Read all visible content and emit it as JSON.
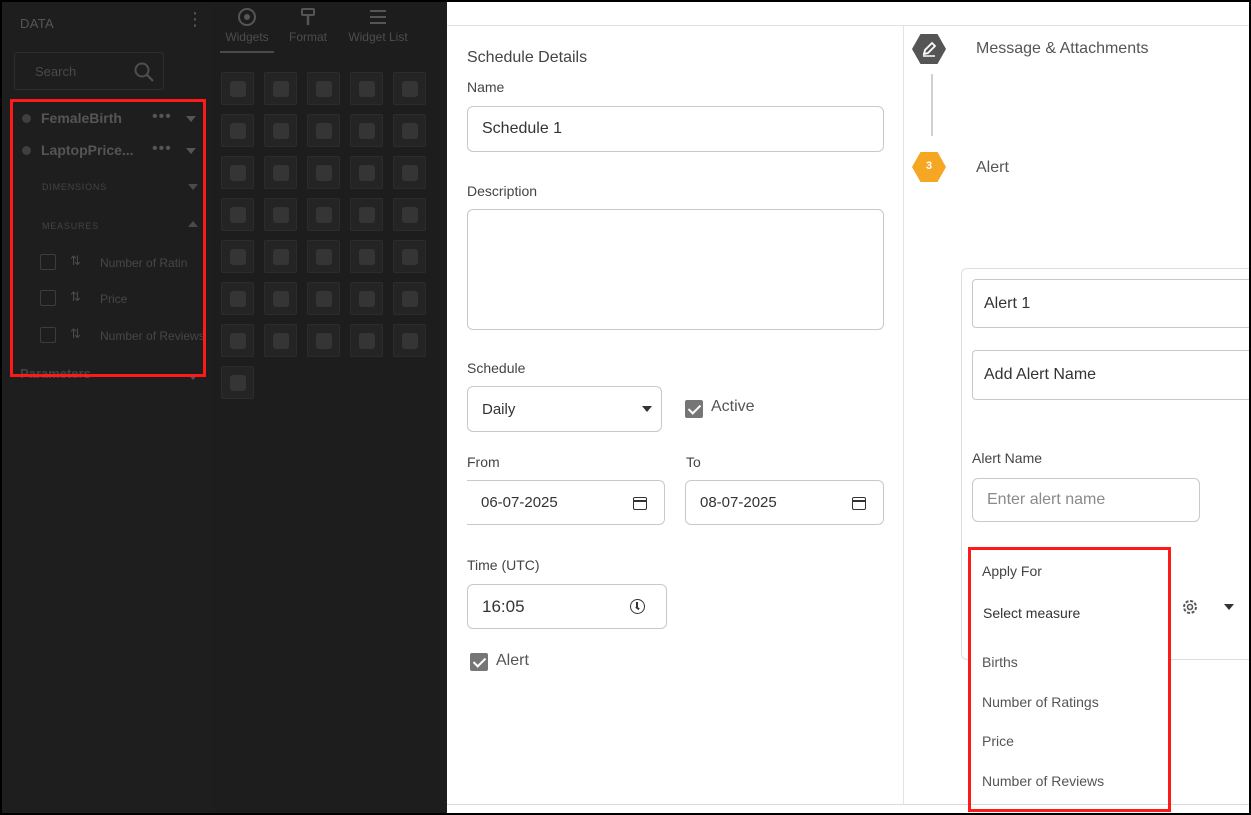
{
  "left_panel": {
    "title": "DATA",
    "search_placeholder": "Search",
    "toolbar": [
      {
        "label": "Widgets",
        "icon": "widgets-icon"
      },
      {
        "label": "Format",
        "icon": "format-icon"
      },
      {
        "label": "Widget List",
        "icon": "widget-list-icon"
      }
    ],
    "datasources": [
      {
        "label": "FemaleBirth",
        "more": "•••"
      },
      {
        "label": "LaptopPrice...",
        "more": "•••"
      }
    ],
    "dimensions_label": "DIMENSIONS",
    "measures_label": "MEASURES",
    "measures": [
      {
        "label": "Number of Ratin",
        "sort": "⇅"
      },
      {
        "label": "Price",
        "sort": "⇅"
      },
      {
        "label": "Number of Reviews",
        "sort": "⇅"
      }
    ],
    "parameters_label": "Parameters"
  },
  "schedule": {
    "section_title": "Schedule Details",
    "name_label": "Name",
    "name_value": "Schedule 1",
    "description_label": "Description",
    "description_value": "",
    "schedule_label": "Schedule",
    "schedule_value": "Daily",
    "active_label": "Active",
    "active_checked": true,
    "from_label": "From",
    "from_value": "06-07-2025",
    "to_label": "To",
    "to_value": "08-07-2025",
    "time_label": "Time (UTC)",
    "time_value": "16:05",
    "alert_label": "Alert",
    "alert_checked": true
  },
  "steps": {
    "step2_label": "Message & Attachments",
    "step3_number": "3",
    "step3_label": "Alert"
  },
  "alert": {
    "alert_title": "Alert 1",
    "add_alert_name": "Add Alert Name",
    "alert_name_label": "Alert Name",
    "alert_name_placeholder": "Enter alert name",
    "apply_for_label": "Apply For",
    "select_measure": "Select measure",
    "options": [
      "Births",
      "Number of Ratings",
      "Price",
      "Number of Reviews"
    ]
  },
  "colors": {
    "highlight": "#ff1a1a",
    "step_active": "#f5a623",
    "step_done": "#555555"
  }
}
